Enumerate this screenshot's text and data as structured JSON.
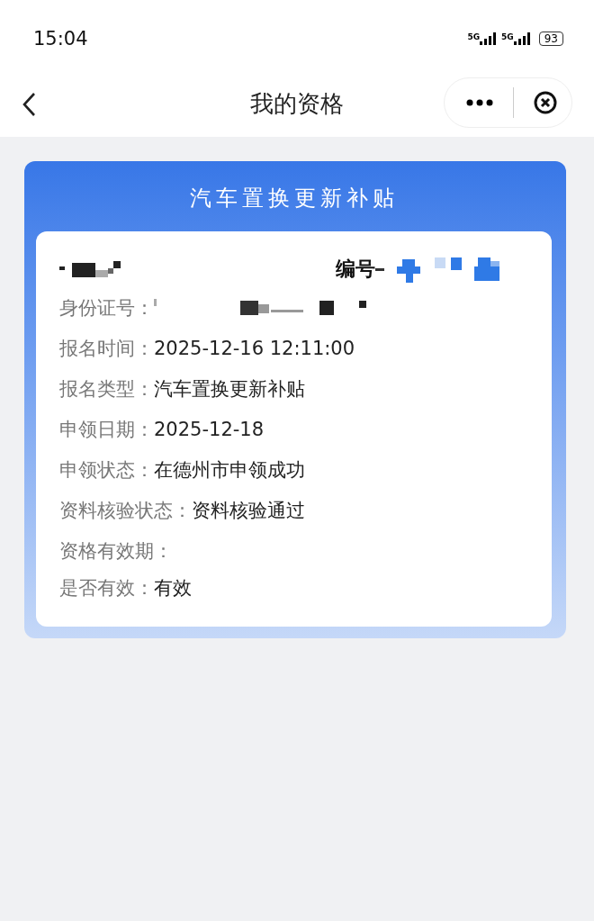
{
  "status_bar": {
    "time": "15:04",
    "networks": [
      {
        "label": "5G"
      },
      {
        "label": "5G"
      }
    ],
    "battery": "93"
  },
  "nav": {
    "title": "我的资格"
  },
  "card": {
    "title": "汽车置换更新补贴",
    "holder": {
      "redacted": true
    },
    "number": {
      "label": "编号",
      "redacted": true
    },
    "fields": [
      {
        "label": "身份证号：",
        "redacted": true
      },
      {
        "label": "报名时间：",
        "value": "2025-12-16 12:11:00",
        "redacted": false
      },
      {
        "label": "报名类型：",
        "value": "汽车置换更新补贴",
        "redacted": false
      },
      {
        "label": "申领日期：",
        "value": "2025-12-18",
        "redacted": false
      },
      {
        "label": "申领状态：",
        "value": "在德州市申领成功",
        "redacted": false
      },
      {
        "label": "资料核验状态：",
        "value": "资料核验通过",
        "redacted": false
      },
      {
        "label": "资格有效期：",
        "redacted": false
      },
      {
        "label": "是否有效：",
        "value": "有效",
        "redacted": false
      }
    ]
  }
}
